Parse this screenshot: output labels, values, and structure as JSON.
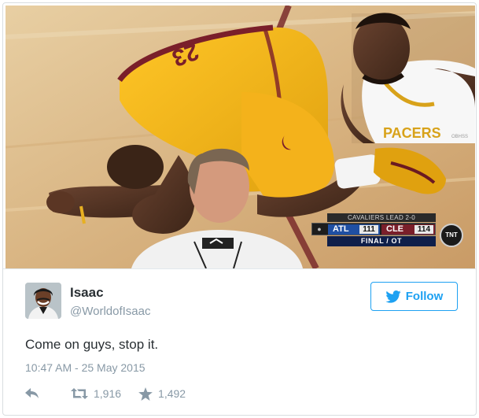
{
  "media": {
    "scoreboard": {
      "series_status": "CAVALIERS LEAD 2-0",
      "team1": {
        "name": "ATL",
        "score": "111"
      },
      "team2": {
        "name": "CLE",
        "score": "114"
      },
      "period": "FINAL / OT",
      "network": "TNT"
    },
    "jersey_number": "23",
    "watermark": "OBHSS"
  },
  "tweet": {
    "display_name": "Isaac",
    "handle": "@WorldofIsaac",
    "follow_label": "Follow",
    "text": "Come on guys, stop it.",
    "timestamp": "10:47 AM - 25 May 2015",
    "retweets": "1,916",
    "likes": "1,492"
  },
  "colors": {
    "twitter_blue": "#1da1f2",
    "muted_text": "#8899a6",
    "primary_text": "#292f33",
    "cavs_wine": "#7a1f2a",
    "cavs_gold": "#f2b51d"
  },
  "icons": {
    "reply": "reply-arrow-icon",
    "retweet": "retweet-icon",
    "like": "star-icon",
    "follow": "twitter-bird-icon"
  }
}
